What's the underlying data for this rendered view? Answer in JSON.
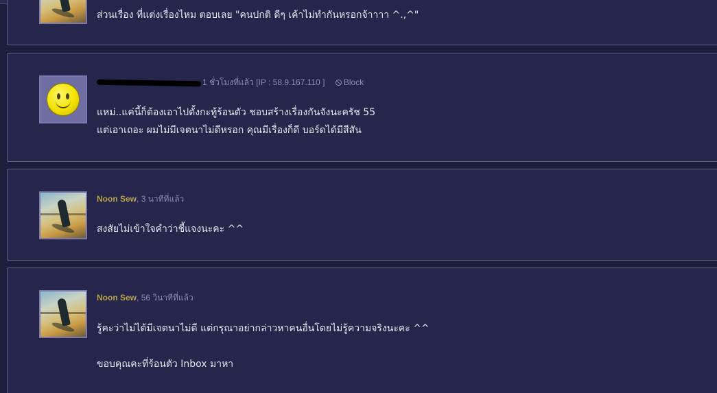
{
  "comments": [
    {
      "body_lines": [
        "ส่วนเรื่อง ที่แต่งเรื่องไหม ตอบเลย \"คนปกติ ดีๆ เค้าไม่ทำกันหรอกจ้าาาา ^.,^\""
      ],
      "avatar_icon": "photo-avatar-icon"
    },
    {
      "author": "",
      "time": "1 ชั่วโมงที่แล้ว",
      "ip": "[IP : 58.9.167.110 ]",
      "block_label": "Block",
      "avatar_icon": "smiley-avatar-icon",
      "body_lines": [
        "แหม่..แค่นี้ก็ต้องเอาไปตั้งกะทู้ร้อนตัว ชอบสร้างเรื่องกันจังนะครัช 55",
        "แต่เอาเถอะ ผมไม่มีเจตนาไม่ดีหรอก คุณมีเรื่องก็ดี บอร์ดได้มีสีสัน"
      ]
    },
    {
      "author": "Noon Sew",
      "time": "3 นาทีที่แล้ว",
      "avatar_icon": "photo-avatar-icon",
      "body_lines": [
        "สงสัยไม่เข้าใจคำว่าชี้แจงนะคะ ^^"
      ]
    },
    {
      "author": "Noon Sew",
      "time": "56 วินาทีที่แล้ว",
      "avatar_icon": "photo-avatar-icon",
      "body_lines": [
        "รู้คะว่าไม่ได้มีเจตนาไม่ดี แต่กรุณาอย่ากล่าวหาคนอื่นโดยไม่รู้ความจริงนะคะ  ^^",
        "",
        "ขอบคุณคะที่ร้อนตัว Inbox มาหา"
      ]
    }
  ],
  "colors": {
    "background": "#1e1d3d",
    "panel": "#26254c",
    "author": "#b8a24a",
    "meta": "#8e8cb6",
    "text": "#e6e6ee"
  }
}
